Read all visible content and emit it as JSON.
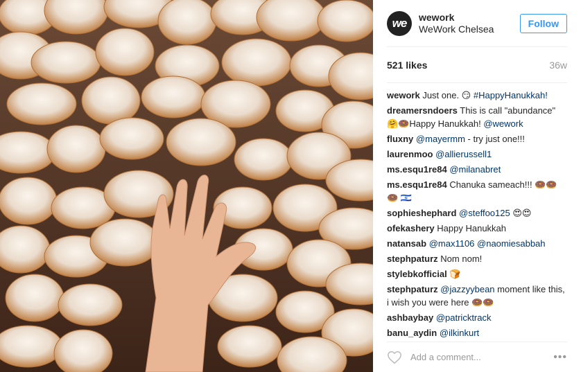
{
  "post": {
    "avatar_text": "we",
    "username": "wework",
    "location": "WeWork Chelsea",
    "follow_label": "Follow",
    "likes": "521 likes",
    "time_ago": "36w"
  },
  "comments": [
    {
      "user": "wework",
      "text": "Just one. 😏",
      "tag": "#HappyHanukkah!"
    },
    {
      "user": "dreamersndoers",
      "text": "This is call \"abundance\" 🤗🍩Happy Hanukkah!",
      "tag": "@wework"
    },
    {
      "user": "fluxny",
      "tag": "@mayermm",
      "text": "- try just one!!!"
    },
    {
      "user": "laurenmoo",
      "tag": "@allierussell1",
      "text": ""
    },
    {
      "user": "ms.esqu1re84",
      "tag": "@milanabret",
      "text": ""
    },
    {
      "user": "ms.esqu1re84",
      "text": "Chanuka sameach!!! 🍩🍩🍩 🇮🇱",
      "tag": ""
    },
    {
      "user": "sophieshephard",
      "tag": "@steffoo125",
      "text": "😍😍"
    },
    {
      "user": "ofekashery",
      "text": "Happy Hanukkah",
      "tag": ""
    },
    {
      "user": "natansab",
      "tag": "@max1106 @naomiesabbah",
      "text": ""
    },
    {
      "user": "stephpaturz",
      "text": "Nom nom!",
      "tag": ""
    },
    {
      "user": "stylebkofficial",
      "text": "🍞",
      "tag": ""
    },
    {
      "user": "stephpaturz",
      "tag": "@jazzyybean",
      "text": "moment like this, i wish you were here 🍩🍩"
    },
    {
      "user": "ashbaybay",
      "tag": "@patricktrack",
      "text": ""
    },
    {
      "user": "banu_aydin",
      "tag": "@ilkinkurt",
      "text": ""
    }
  ],
  "add_comment": {
    "placeholder": "Add a comment...",
    "more_label": "•••"
  },
  "icons": {
    "heart": "heart-outline-icon",
    "more": "more-options-icon"
  },
  "colors": {
    "follow_blue": "#3897f0",
    "mention": "#003569"
  }
}
